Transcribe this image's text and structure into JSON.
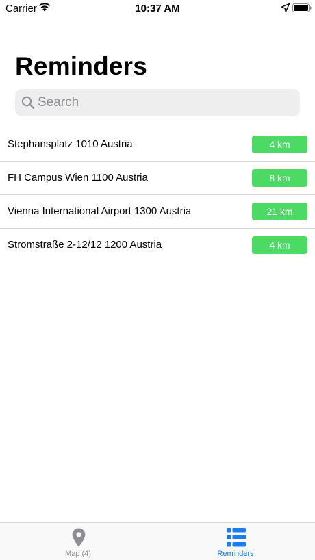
{
  "status_bar": {
    "carrier": "Carrier",
    "time": "10:37 AM",
    "icons": [
      "wifi-icon",
      "location-arrow-icon",
      "battery-icon"
    ]
  },
  "title": "Reminders",
  "search": {
    "placeholder": "Search",
    "value": ""
  },
  "reminders": [
    {
      "address": "Stephansplatz 1010 Austria",
      "distance": "4 km"
    },
    {
      "address": "FH Campus Wien 1100 Austria",
      "distance": "8 km"
    },
    {
      "address": "Vienna International Airport 1300 Austria",
      "distance": "21 km"
    },
    {
      "address": "Stromstraße 2-12/12 1200 Austria",
      "distance": "4 km"
    }
  ],
  "tab_bar": {
    "tabs": [
      {
        "label": "Map (4)",
        "icon": "map-pin-icon",
        "selected": false
      },
      {
        "label": "Reminders",
        "icon": "list-icon",
        "selected": true
      }
    ]
  },
  "colors": {
    "badge": "#4cd964",
    "accent": "#1a7cf2",
    "inactive_tab": "#8e8e93",
    "search_bg": "#eeeeef"
  }
}
